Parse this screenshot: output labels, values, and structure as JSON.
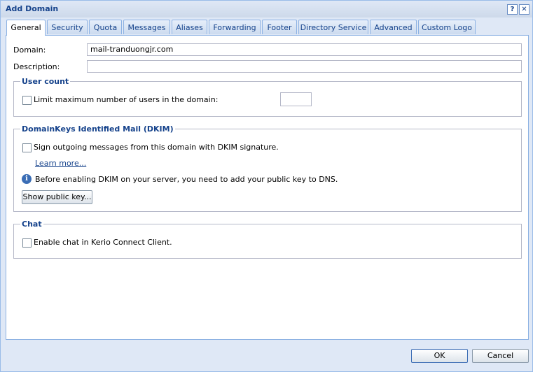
{
  "window": {
    "title": "Add Domain"
  },
  "titlebar": {
    "help_glyph": "?",
    "close_glyph": "✕"
  },
  "tabs": [
    {
      "label": "General",
      "active": true
    },
    {
      "label": "Security"
    },
    {
      "label": "Quota"
    },
    {
      "label": "Messages"
    },
    {
      "label": "Aliases"
    },
    {
      "label": "Forwarding"
    },
    {
      "label": "Footer"
    },
    {
      "label": "Directory Service"
    },
    {
      "label": "Advanced"
    },
    {
      "label": "Custom Logo"
    }
  ],
  "general": {
    "domain_label": "Domain:",
    "domain_value": "mail-tranduongjr.com",
    "description_label": "Description:",
    "description_value": ""
  },
  "user_count": {
    "legend": "User count",
    "limit_label": "Limit maximum number of users in the domain:",
    "limit_checked": false,
    "limit_value": ""
  },
  "dkim": {
    "legend": "DomainKeys Identified Mail (DKIM)",
    "sign_label": "Sign outgoing messages from this domain with DKIM signature.",
    "sign_checked": false,
    "learn_more": "Learn more...",
    "info_glyph": "i",
    "info_text": "Before enabling DKIM on your server, you need to add your public key to DNS.",
    "show_key_button": "Show public key..."
  },
  "chat": {
    "legend": "Chat",
    "enable_label": "Enable chat in Kerio Connect Client.",
    "enable_checked": false
  },
  "footer": {
    "ok": "OK",
    "cancel": "Cancel"
  }
}
